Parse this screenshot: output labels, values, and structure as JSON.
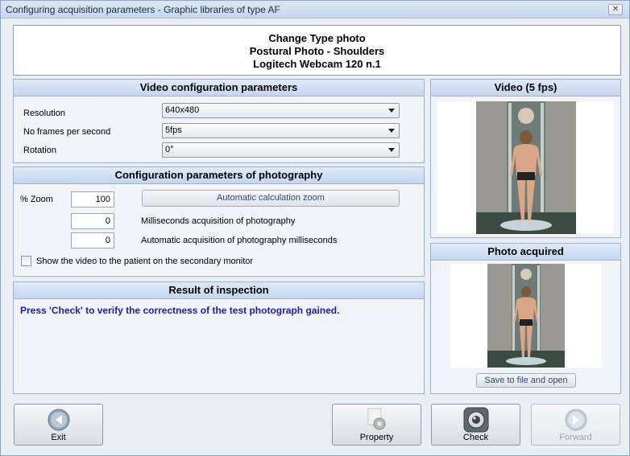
{
  "window": {
    "title": "Configuring acquisition parameters - Graphic libraries of type AF"
  },
  "banner": {
    "line1": "Change Type photo",
    "line2": "Postural Photo - Shoulders",
    "line3": "Logitech Webcam 120 n.1"
  },
  "video_config": {
    "title": "Video configuration parameters",
    "resolution": {
      "label": "Resolution",
      "value": "640x480"
    },
    "fps": {
      "label": "No frames per second",
      "value": "5fps"
    },
    "rotation": {
      "label": "Rotation",
      "value": "0°"
    }
  },
  "photo_config": {
    "title": "Configuration parameters of photography",
    "zoom": {
      "label": "% Zoom",
      "value": "100"
    },
    "auto_zoom_button": "Automatic calculation zoom",
    "ms_acquisition": {
      "label": "Milliseconds acquisition of photography",
      "value": "0"
    },
    "auto_ms": {
      "label": "Automatic acquisition of photography milliseconds",
      "value": "0"
    },
    "secondary_monitor": {
      "label": "Show the video to the patient on the secondary monitor",
      "checked": false
    }
  },
  "result": {
    "title": "Result of inspection",
    "message": "Press 'Check' to verify the correctness of the test photograph gained."
  },
  "video_panel": {
    "title": "Video (5 fps)"
  },
  "photo_panel": {
    "title": "Photo acquired",
    "save_button": "Save to file and open"
  },
  "buttons": {
    "exit": "Exit",
    "property": "Property",
    "check": "Check",
    "forward": "Forward"
  },
  "icons": {
    "exit": "arrow-left-circle-icon",
    "property": "gear-document-icon",
    "check": "webcam-icon",
    "forward": "arrow-right-circle-icon"
  },
  "colors": {
    "result_text": "#1e1ea8",
    "header_gradient": "#c4d6ee"
  }
}
